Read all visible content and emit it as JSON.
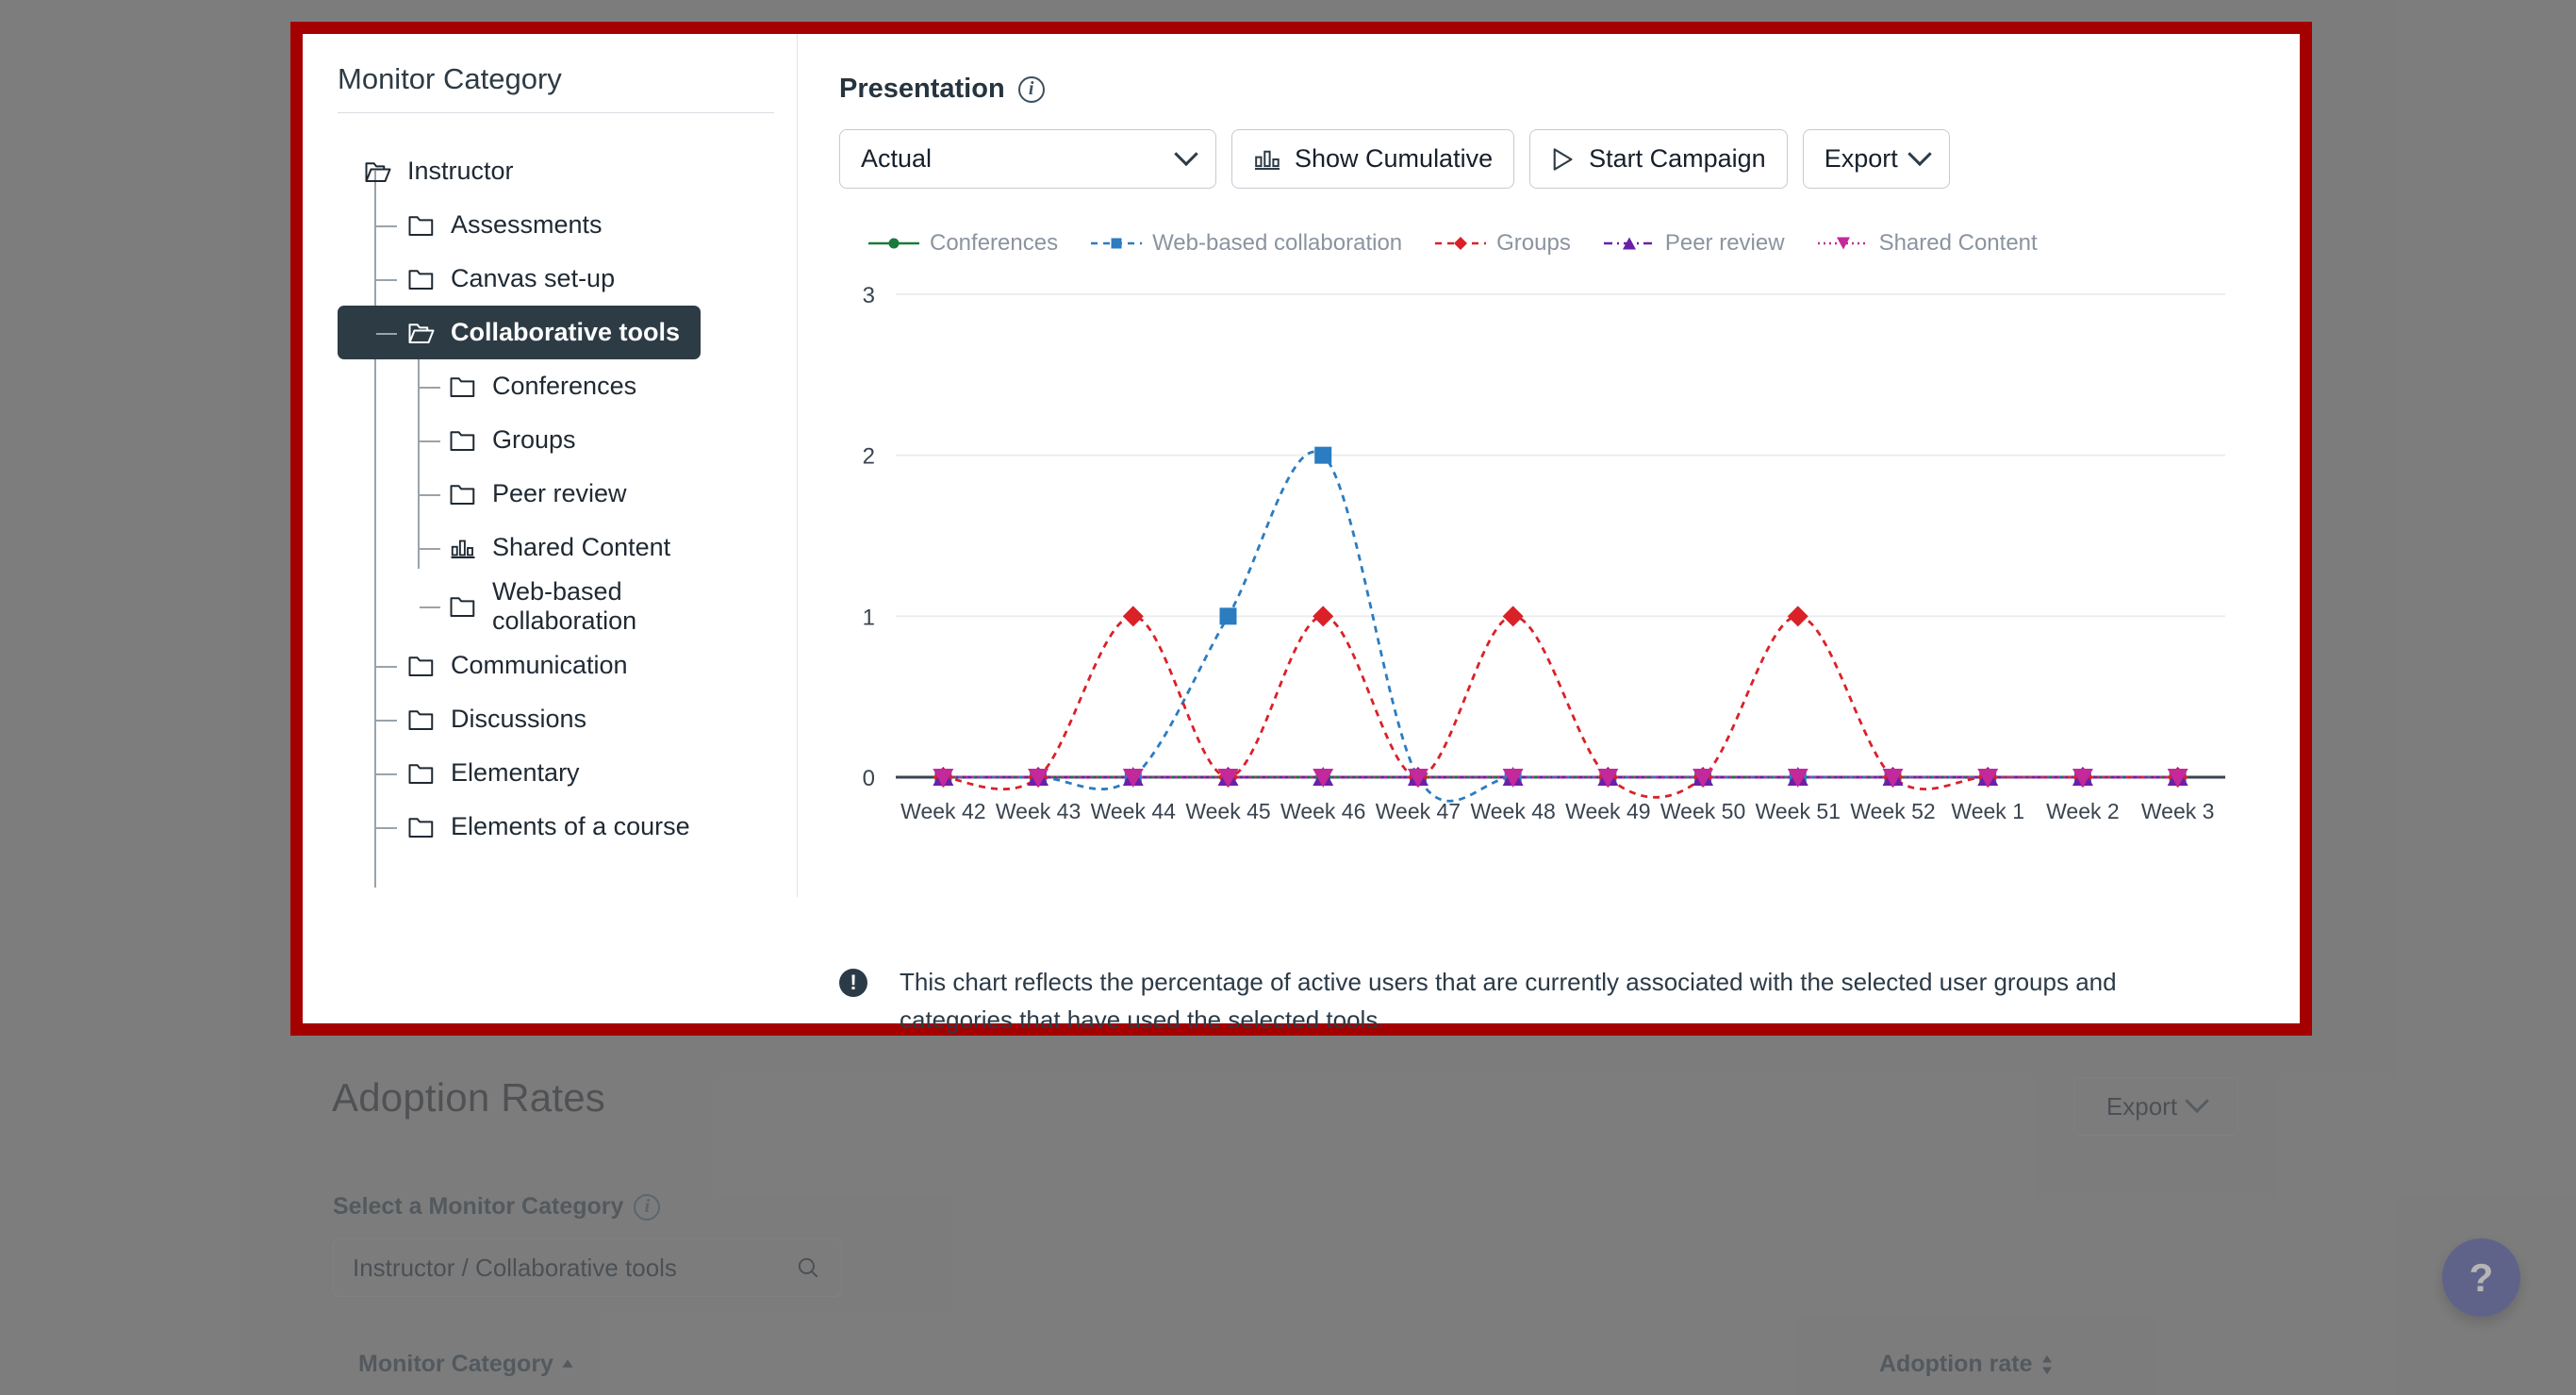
{
  "background": {
    "section_title": "Adoption Rates",
    "export_label": "Export",
    "select_label": "Select a Monitor Category",
    "select_value": "Instructor / Collaborative tools",
    "column_monitor_category": "Monitor Category",
    "column_adoption_rate": "Adoption rate",
    "help_glyph": "?"
  },
  "tree_panel": {
    "title": "Monitor Category",
    "items": [
      {
        "label": "Instructor",
        "level": 1,
        "icon": "folder-open-icon",
        "selected": false
      },
      {
        "label": "Assessments",
        "level": 2,
        "icon": "folder-icon",
        "selected": false
      },
      {
        "label": "Canvas set-up",
        "level": 2,
        "icon": "folder-icon",
        "selected": false
      },
      {
        "label": "Collaborative tools",
        "level": 2,
        "icon": "folder-open-icon",
        "selected": true
      },
      {
        "label": "Conferences",
        "level": 3,
        "icon": "folder-icon",
        "selected": false
      },
      {
        "label": "Groups",
        "level": 3,
        "icon": "folder-icon",
        "selected": false
      },
      {
        "label": "Peer review",
        "level": 3,
        "icon": "folder-icon",
        "selected": false
      },
      {
        "label": "Shared Content",
        "level": 3,
        "icon": "bar-chart-icon",
        "selected": false
      },
      {
        "label": "Web-based collaboration",
        "level": 3,
        "icon": "folder-icon",
        "selected": false
      },
      {
        "label": "Communication",
        "level": 2,
        "icon": "folder-icon",
        "selected": false
      },
      {
        "label": "Discussions",
        "level": 2,
        "icon": "folder-icon",
        "selected": false
      },
      {
        "label": "Elementary",
        "level": 2,
        "icon": "folder-icon",
        "selected": false
      },
      {
        "label": "Elements of a course",
        "level": 2,
        "icon": "folder-icon",
        "selected": false
      }
    ]
  },
  "chart_panel": {
    "heading": "Presentation",
    "toolbar": {
      "presentation_value": "Actual",
      "show_cumulative_label": "Show Cumulative",
      "start_campaign_label": "Start Campaign",
      "export_label": "Export"
    },
    "note": "This chart reflects the percentage of active users that are currently associated with the selected user groups and categories that have used the selected tools."
  },
  "chart_data": {
    "type": "line",
    "title": "",
    "xlabel": "",
    "ylabel": "",
    "ylim": [
      0,
      3
    ],
    "yticks": [
      0,
      1,
      2,
      3
    ],
    "grid": true,
    "legend_position": "top",
    "interpolation": "spline",
    "categories": [
      "Week 42",
      "Week 43",
      "Week 44",
      "Week 45",
      "Week 46",
      "Week 47",
      "Week 48",
      "Week 49",
      "Week 50",
      "Week 51",
      "Week 52",
      "Week 1",
      "Week 2",
      "Week 3"
    ],
    "series": [
      {
        "name": "Conferences",
        "color": "#1A7A3C",
        "marker": "circle",
        "dash": "solid",
        "values": [
          0,
          0,
          0,
          0,
          0,
          0,
          0,
          0,
          0,
          0,
          0,
          0,
          0,
          0
        ]
      },
      {
        "name": "Web-based collaboration",
        "color": "#2B7CC0",
        "marker": "square",
        "dash": "dashed",
        "values": [
          0,
          0,
          0,
          1,
          2,
          0,
          0,
          0,
          0,
          0,
          0,
          0,
          0,
          0
        ]
      },
      {
        "name": "Groups",
        "color": "#DA2128",
        "marker": "diamond",
        "dash": "dashed",
        "values": [
          0,
          0,
          1,
          0,
          1,
          0,
          1,
          0,
          0,
          1,
          0,
          0,
          0,
          0
        ]
      },
      {
        "name": "Peer review",
        "color": "#6B1FA8",
        "marker": "triangle-up",
        "dash": "dashdot",
        "values": [
          0,
          0,
          0,
          0,
          0,
          0,
          0,
          0,
          0,
          0,
          0,
          0,
          0,
          0
        ]
      },
      {
        "name": "Shared Content",
        "color": "#C3299B",
        "marker": "triangle-down",
        "dash": "dotted",
        "values": [
          0,
          0,
          0,
          0,
          0,
          0,
          0,
          0,
          0,
          0,
          0,
          0,
          0,
          0
        ]
      }
    ]
  }
}
